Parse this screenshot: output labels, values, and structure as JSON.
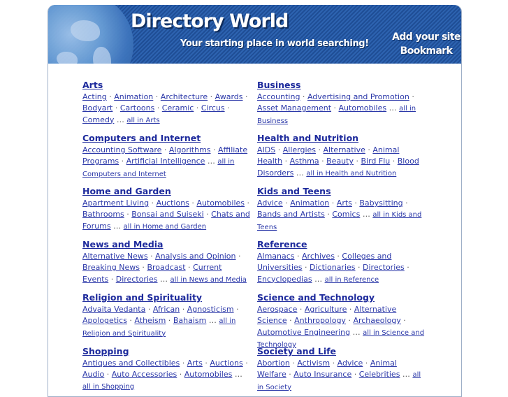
{
  "header": {
    "title": "Directory World",
    "tagline": "Your starting place in world searching!",
    "add_site": "Add your site",
    "bookmark": "Bookmark"
  },
  "categories": [
    {
      "title": "Arts",
      "links": [
        "Acting",
        "Animation",
        "Architecture",
        "Awards",
        "Bodyart",
        "Cartoons",
        "Ceramic",
        "Circus",
        "Comedy"
      ],
      "all": "all in Arts"
    },
    {
      "title": "Business",
      "links": [
        "Accounting",
        "Advertising and Promotion",
        "Asset Management",
        "Automobiles"
      ],
      "all": "all in Business"
    },
    {
      "title": "Computers and Internet",
      "links": [
        "Accounting Software",
        "Algorithms",
        "Affiliate Programs",
        "Artificial Intelligence"
      ],
      "all": "all in Computers and Internet"
    },
    {
      "title": "Health and Nutrition",
      "links": [
        "AIDS",
        "Allergies",
        "Alternative",
        "Animal Health",
        "Asthma",
        "Beauty",
        "Bird Flu",
        "Blood Disorders"
      ],
      "all": "all in Health and Nutrition"
    },
    {
      "title": "Home and Garden",
      "links": [
        "Apartment Living",
        "Auctions",
        "Automobiles",
        "Bathrooms",
        "Bonsai and Suiseki",
        "Chats and Forums"
      ],
      "all": "all in Home and Garden"
    },
    {
      "title": "Kids and Teens",
      "links": [
        "Advice",
        "Animation",
        "Arts",
        "Babysitting",
        "Bands and Artists",
        "Comics"
      ],
      "all": "all in Kids and Teens"
    },
    {
      "title": "News and Media",
      "links": [
        "Alternative News",
        "Analysis and Opinion",
        "Breaking News",
        "Broadcast",
        "Current Events",
        "Directories"
      ],
      "all": "all in News and Media"
    },
    {
      "title": "Reference",
      "links": [
        "Almanacs",
        "Archives",
        "Colleges and Universities",
        "Dictionaries",
        "Directories",
        "Encyclopedias"
      ],
      "all": "all in Reference"
    },
    {
      "title": "Religion and Spirituality",
      "links": [
        "Advaita Vedanta",
        "African",
        "Agnosticism",
        "Apologetics",
        "Atheism",
        "Bahaism"
      ],
      "all": "all in Religion and Spirituality"
    },
    {
      "title": "Science and Technology",
      "links": [
        "Aerospace",
        "Agriculture",
        "Alternative Science",
        "Anthropology",
        "Archaeology",
        "Automotive Engineering"
      ],
      "all": "all in Science and Technology"
    },
    {
      "title": "Shopping",
      "links": [
        "Antiques and Collectibles",
        "Arts",
        "Auctions",
        "Audio",
        "Auto Accessories",
        "Automobiles"
      ],
      "all": "all in Shopping"
    },
    {
      "title": "Society and Life",
      "links": [
        "Abortion",
        "Activism",
        "Advice",
        "Animal Welfare",
        "Auto Insurance",
        "Celebrities"
      ],
      "all": "all in Society"
    }
  ]
}
